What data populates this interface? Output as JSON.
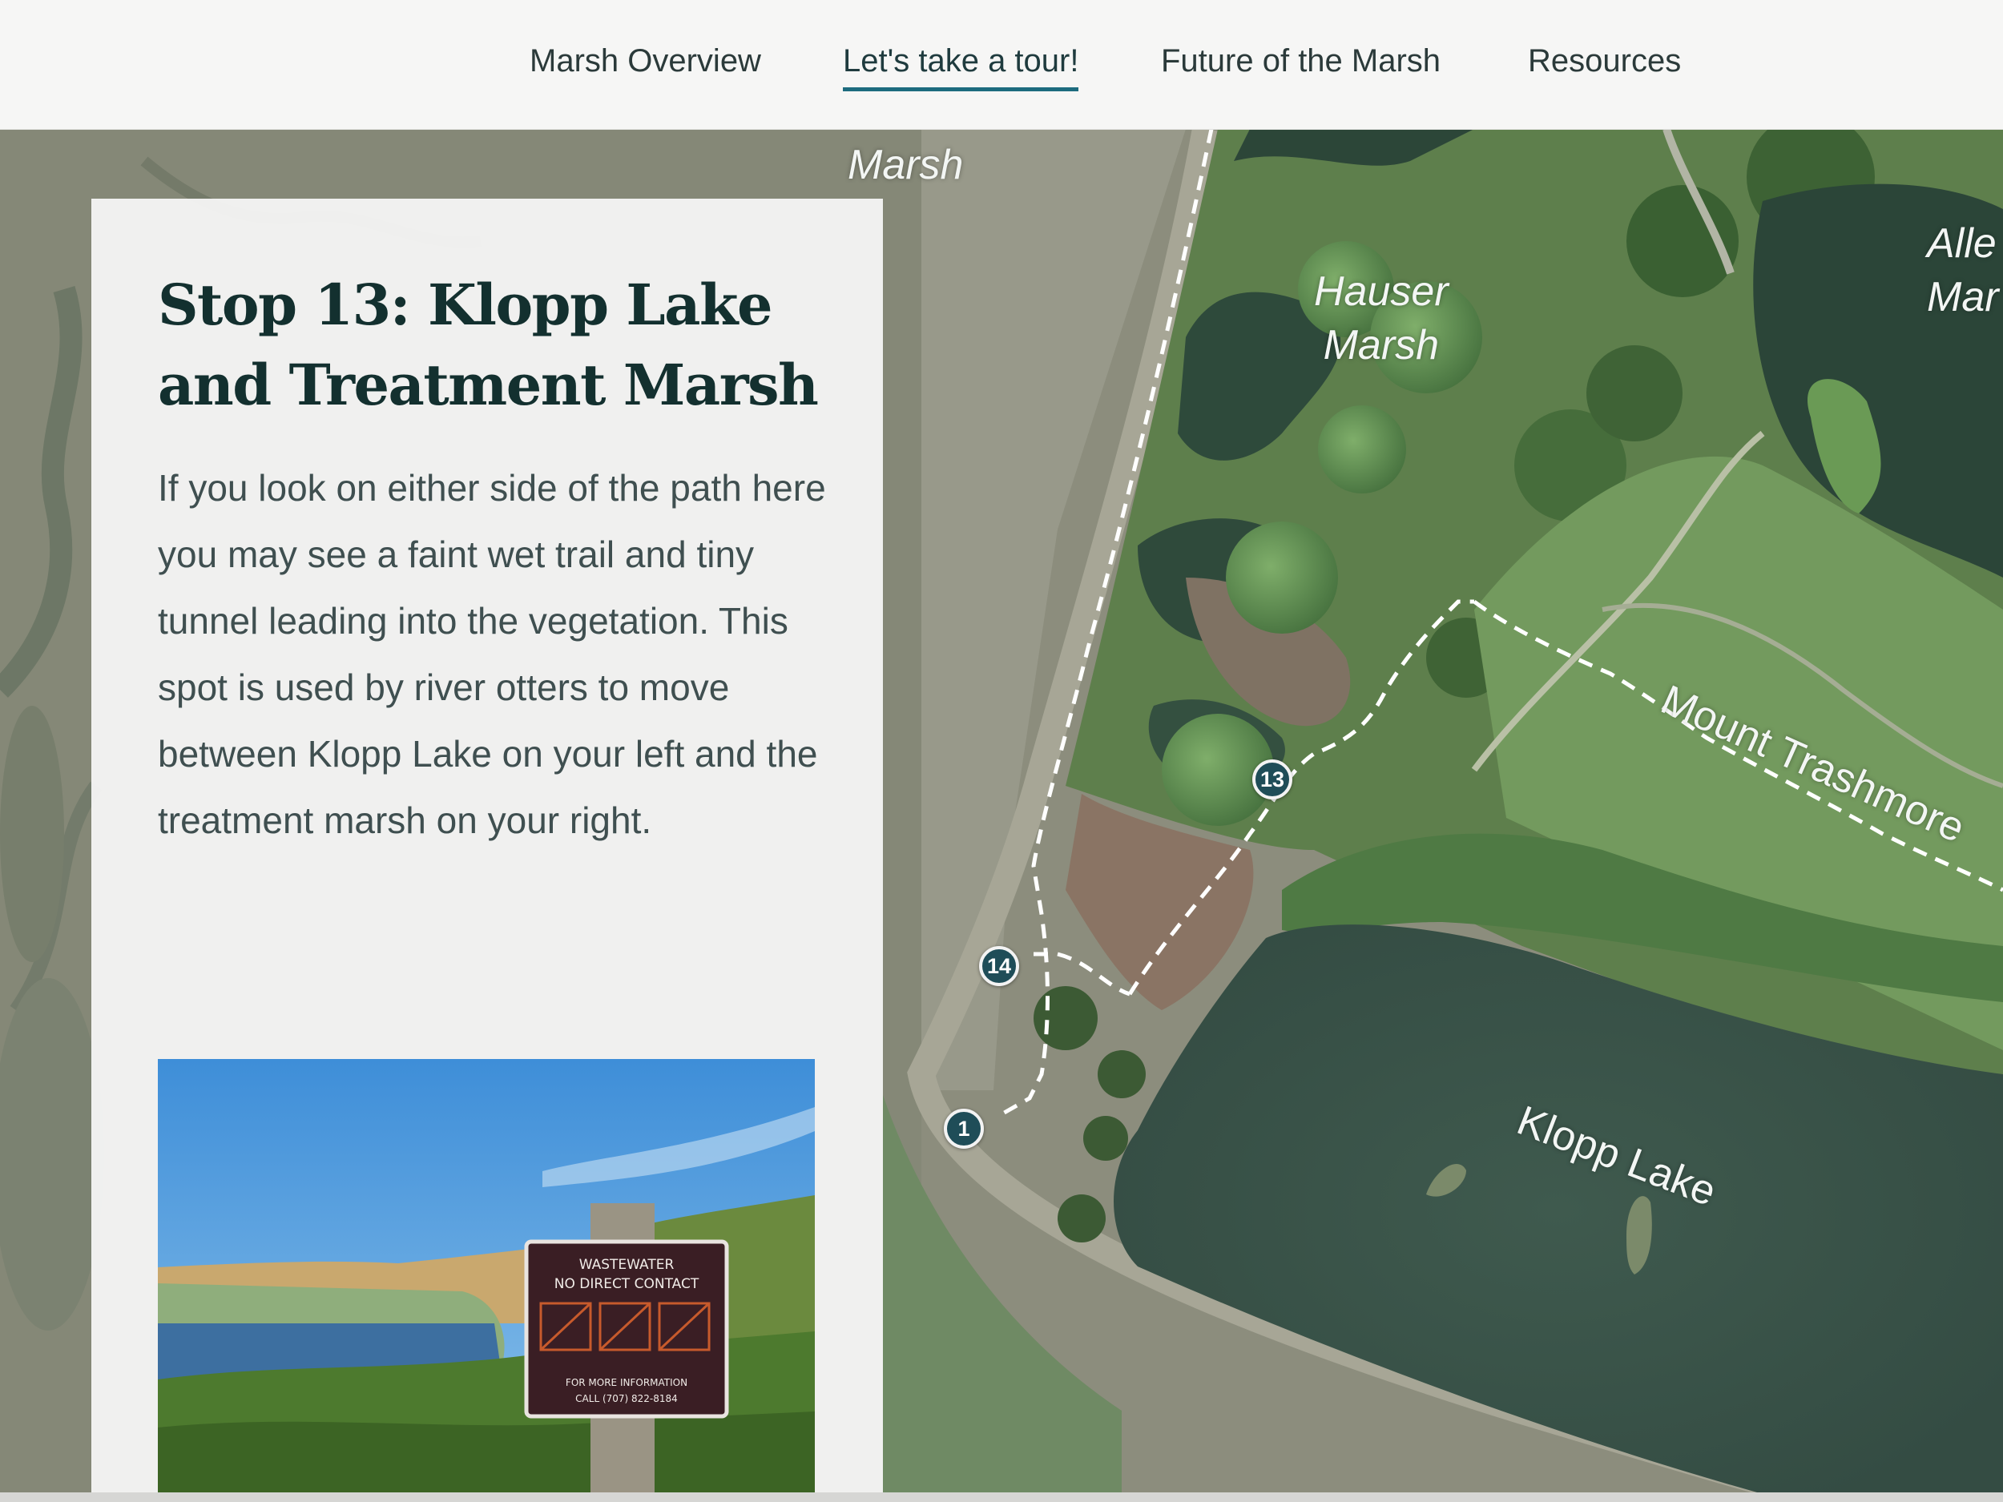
{
  "nav": {
    "items": [
      {
        "label": "Marsh Overview"
      },
      {
        "label": "Let's take a tour!"
      },
      {
        "label": "Future of the Marsh"
      },
      {
        "label": "Resources"
      }
    ],
    "active_index": 1,
    "accent_color": "#1d6b7e"
  },
  "map": {
    "labels": {
      "marsh_top": "Marsh",
      "hauser_line1": "Hauser",
      "hauser_line2": "Marsh",
      "allen_line1": "Alle",
      "allen_line2": "Mar",
      "mount_trashmore": "Mount Trashmore",
      "klopp_lake": "Klopp Lake"
    },
    "markers": [
      {
        "label": "13"
      },
      {
        "label": "14"
      },
      {
        "label": "1"
      }
    ]
  },
  "panel": {
    "title": "Stop 13: Klopp Lake and Treatment Marsh",
    "body": "If you look on either side of the path here you may see a faint wet trail and tiny tunnel leading into the vegetation. This spot is used by river otters to move between Klopp Lake on your left and the treatment marsh on your right."
  },
  "photo": {
    "sign": {
      "line1": "WASTEWATER",
      "line2": "NO DIRECT CONTACT",
      "line3": "FOR MORE INFORMATION",
      "line4": "CALL (707) 822-8184"
    }
  }
}
